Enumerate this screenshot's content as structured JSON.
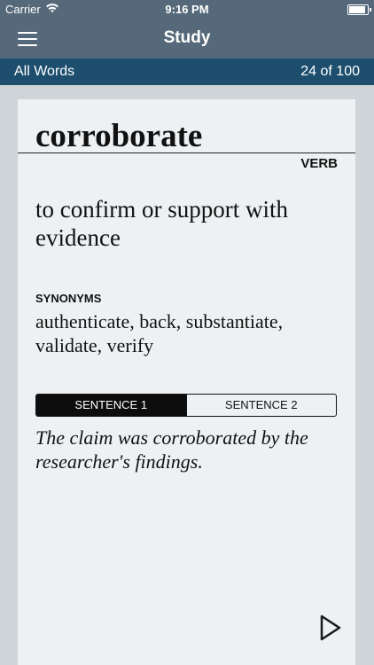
{
  "status_bar": {
    "carrier": "Carrier",
    "time": "9:16 PM",
    "icons": [
      "wifi-icon",
      "battery-icon"
    ]
  },
  "nav": {
    "title": "Study",
    "menu_icon": "hamburger-menu-icon"
  },
  "sub_bar": {
    "deck": "All Words",
    "progress": "24 of 100"
  },
  "card": {
    "word": "corroborate",
    "part_of_speech": "VERB",
    "definition": "to confirm or support with evidence",
    "synonyms_label": "SYNONYMS",
    "synonyms": "authenticate, back, substantiate, validate, verify",
    "tabs": [
      {
        "label": "SENTENCE 1",
        "selected": true
      },
      {
        "label": "SENTENCE 2",
        "selected": false
      }
    ],
    "sentence": "The claim was corroborated by the researcher's findings.",
    "next_icon": "play-next-icon"
  },
  "colors": {
    "nav_bg": "#56697a",
    "sub_bar_bg": "#1d4e6d",
    "card_bg": "#eef1f3",
    "page_bg": "#cfd4d8"
  }
}
